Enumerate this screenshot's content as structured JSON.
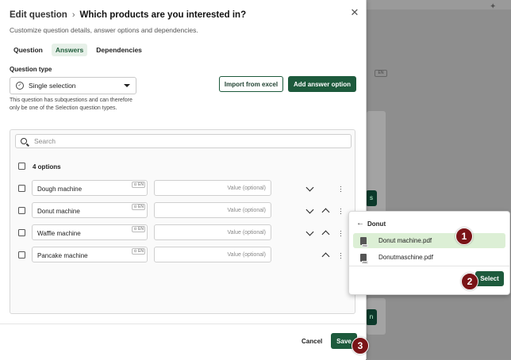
{
  "modal": {
    "title_prefix": "Edit question",
    "title_main": "Which products are you interested in?",
    "subtitle": "Customize question details, answer options and dependencies.",
    "tabs": [
      {
        "label": "Question"
      },
      {
        "label": "Answers",
        "active": true
      },
      {
        "label": "Dependencies"
      }
    ]
  },
  "question_type": {
    "label": "Question type",
    "value": "Single selection",
    "note": "This question has subquestions and can therefore only be one of the Selection question types."
  },
  "actions": {
    "import_label": "Import from excel",
    "add_label": "Add answer option"
  },
  "options": {
    "search_placeholder": "Search",
    "count_label": "4 options",
    "lang_badge": "EN",
    "value_placeholder": "Value (optional)",
    "items": [
      {
        "name": "Dough machine"
      },
      {
        "name": "Donut machine"
      },
      {
        "name": "Waffle machine"
      },
      {
        "name": "Pancake machine"
      }
    ]
  },
  "footer": {
    "cancel_label": "Cancel",
    "save_label": "Save"
  },
  "file_picker": {
    "folder": "Donut",
    "files": [
      {
        "name": "Donut machine.pdf",
        "selected": true
      },
      {
        "name": "Donutmaschine.pdf",
        "selected": false
      }
    ],
    "select_label": "Select"
  },
  "steps": [
    "1",
    "2",
    "3"
  ],
  "background": {
    "badge": "EN",
    "buttons": [
      "s",
      "n"
    ]
  },
  "colors": {
    "accent": "#1d5a3c",
    "selected_row": "#dcefd5",
    "step_badge": "#7a1417"
  }
}
